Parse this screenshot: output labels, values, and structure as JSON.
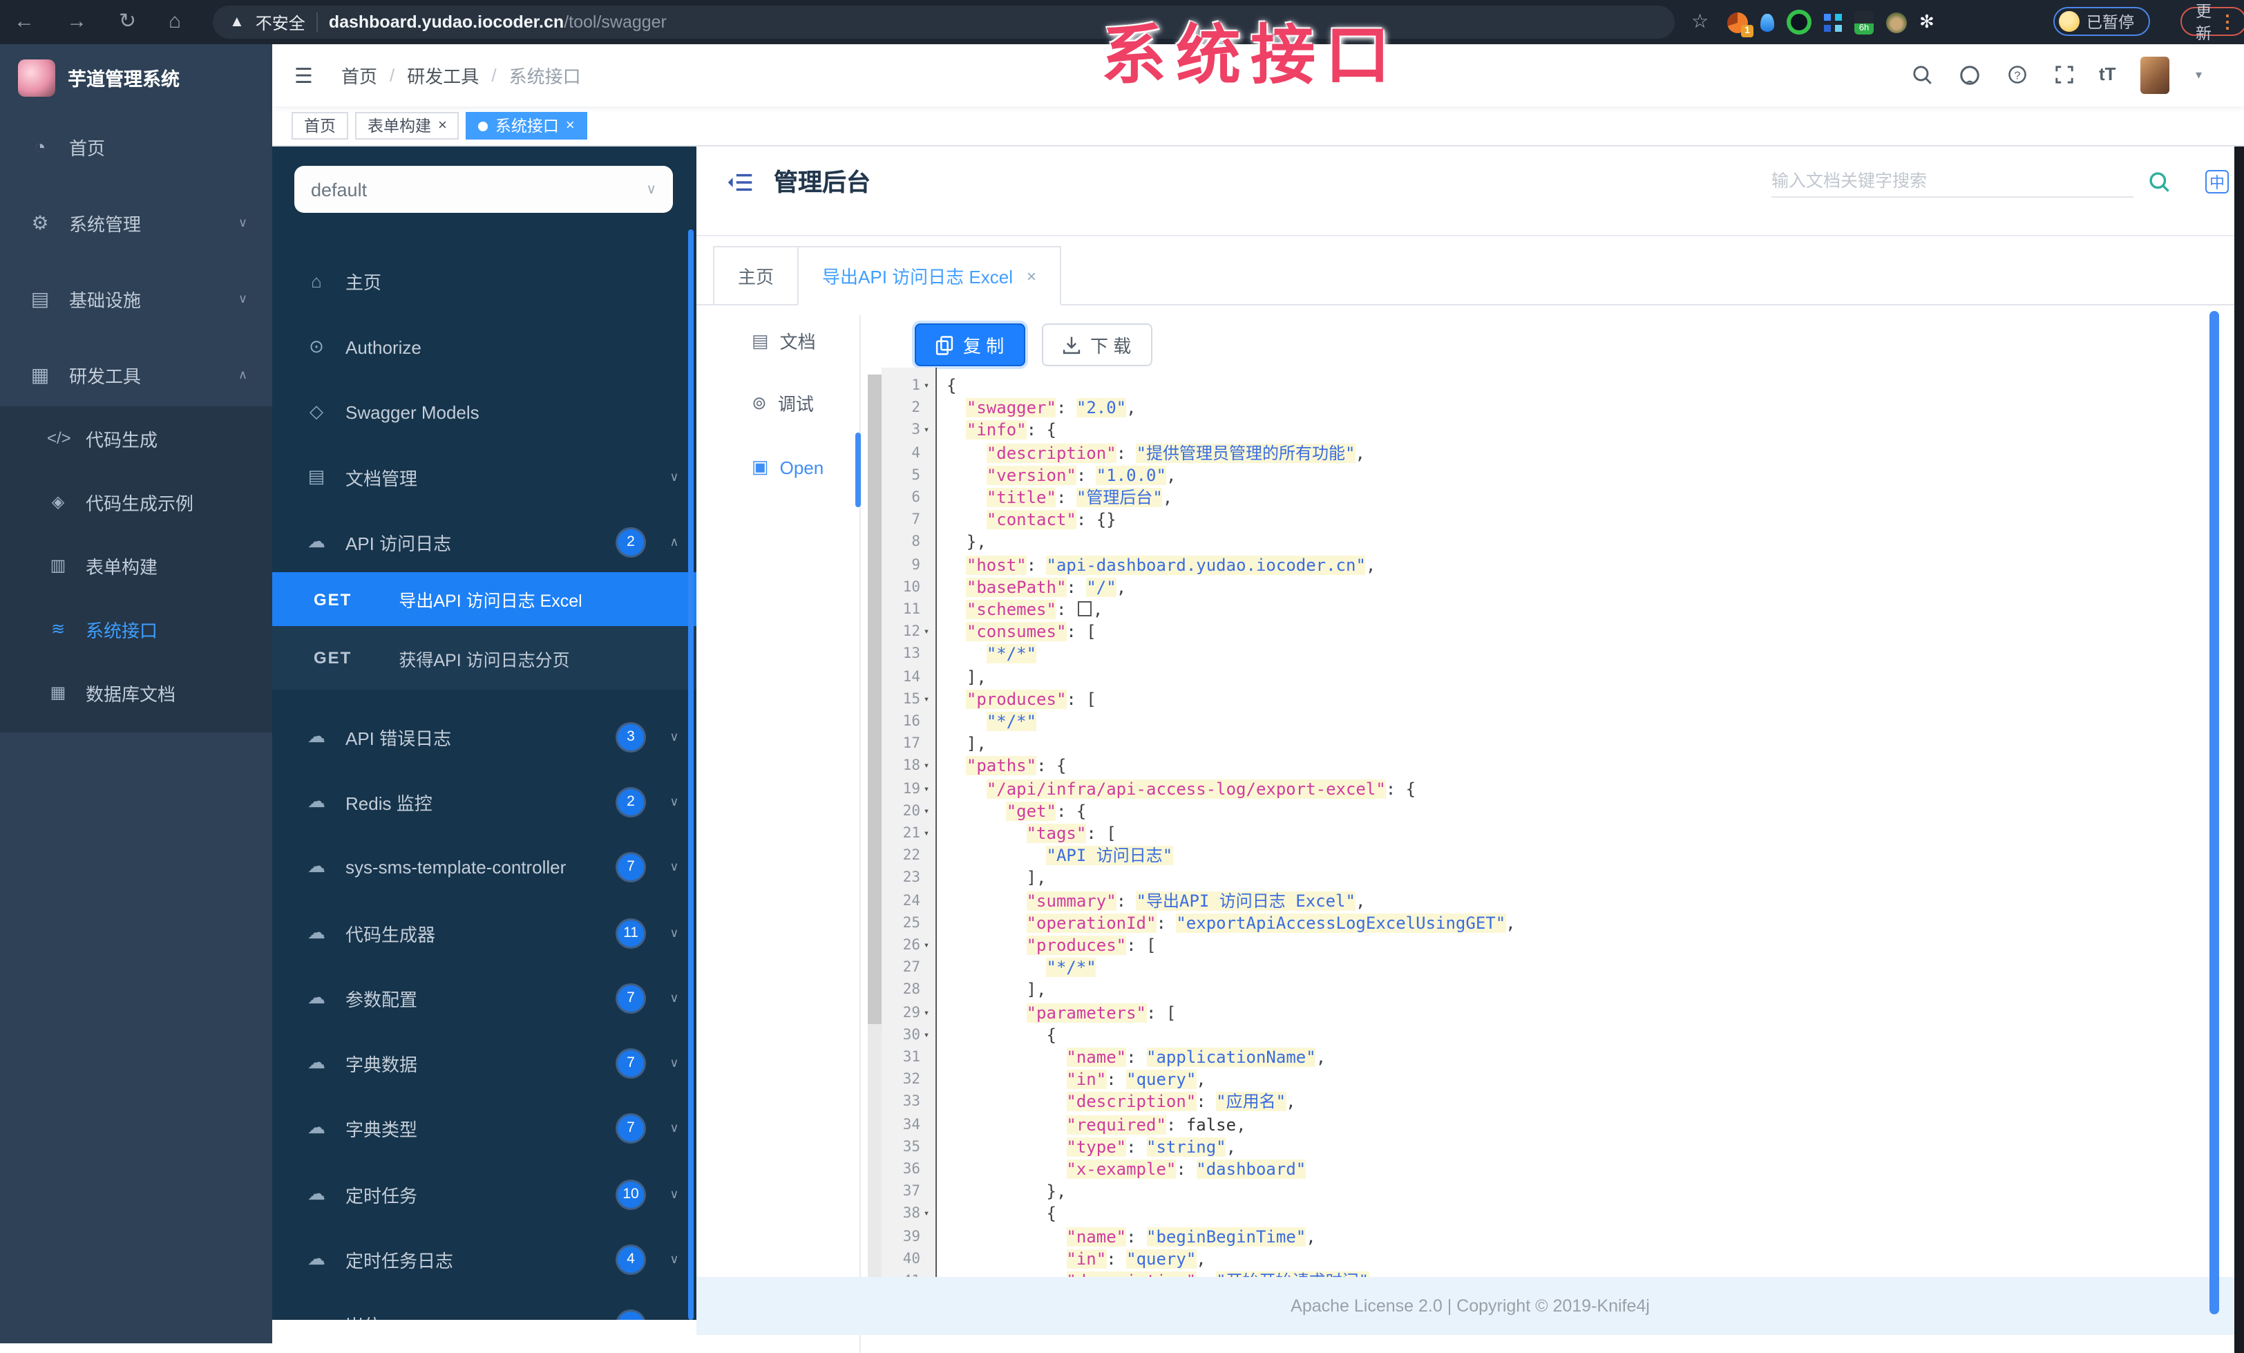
{
  "watermark": "系统接口",
  "colors": {
    "accent": "#1e80fe",
    "menu_active": "#409eff",
    "watermark": "#ee4165",
    "code_key": "#cf3c9f",
    "code_string": "#3a6ce0",
    "doc_panel": "#16344b",
    "sidebar": "#2e4156"
  },
  "browser": {
    "security_label": "不安全",
    "url_host": "dashboard.yudao.iocoder.cn",
    "url_path": "/tool/swagger",
    "ext_badge": "1",
    "ext_bottle_label": "6h",
    "paused_label": "已暂停",
    "update_label": "更新"
  },
  "app": {
    "logo_title": "芋道管理系统",
    "breadcrumb": [
      "首页",
      "研发工具",
      "系统接口"
    ],
    "tags": [
      {
        "label": "首页",
        "active": false,
        "closable": false
      },
      {
        "label": "表单构建",
        "active": false,
        "closable": true
      },
      {
        "label": "系统接口",
        "active": true,
        "closable": true
      }
    ]
  },
  "sidebar": {
    "items": [
      {
        "label": "首页",
        "icon": "dashboard-icon"
      },
      {
        "label": "系统管理",
        "icon": "gear-icon",
        "arrow": "down"
      },
      {
        "label": "基础设施",
        "icon": "monitor-icon",
        "arrow": "down"
      },
      {
        "label": "研发工具",
        "icon": "toolbox-icon",
        "arrow": "up"
      }
    ],
    "subitems": [
      {
        "label": "代码生成",
        "icon": "code-icon"
      },
      {
        "label": "代码生成示例",
        "icon": "shield-icon"
      },
      {
        "label": "表单构建",
        "icon": "form-icon"
      },
      {
        "label": "系统接口",
        "icon": "swagger-icon",
        "active": true
      },
      {
        "label": "数据库文档",
        "icon": "db-icon"
      }
    ]
  },
  "docmenu": {
    "group_select_value": "default",
    "items": [
      {
        "type": "item",
        "label": "主页",
        "icon": "home-icon"
      },
      {
        "type": "item",
        "label": "Authorize",
        "icon": "lock-icon"
      },
      {
        "type": "item",
        "label": "Swagger Models",
        "icon": "models-icon"
      },
      {
        "type": "group",
        "label": "文档管理",
        "icon": "doc-icon",
        "arrow": "down"
      },
      {
        "type": "group",
        "label": "API 访问日志",
        "icon": "api-icon",
        "badge": "2",
        "arrow": "up"
      },
      {
        "type": "api",
        "method": "GET",
        "label": "导出API 访问日志 Excel",
        "active": true
      },
      {
        "type": "api",
        "method": "GET",
        "label": "获得API 访问日志分页"
      },
      {
        "type": "group",
        "label": "API 错误日志",
        "icon": "api-icon",
        "badge": "3",
        "arrow": "down"
      },
      {
        "type": "group",
        "label": "Redis 监控",
        "icon": "api-icon",
        "badge": "2",
        "arrow": "down"
      },
      {
        "type": "group",
        "label": "sys-sms-template-controller",
        "icon": "api-icon",
        "badge": "7",
        "arrow": "down"
      },
      {
        "type": "group",
        "label": "代码生成器",
        "icon": "api-icon",
        "badge": "11",
        "arrow": "down"
      },
      {
        "type": "group",
        "label": "参数配置",
        "icon": "api-icon",
        "badge": "7",
        "arrow": "down"
      },
      {
        "type": "group",
        "label": "字典数据",
        "icon": "api-icon",
        "badge": "7",
        "arrow": "down"
      },
      {
        "type": "group",
        "label": "字典类型",
        "icon": "api-icon",
        "badge": "7",
        "arrow": "down"
      },
      {
        "type": "group",
        "label": "定时任务",
        "icon": "api-icon",
        "badge": "10",
        "arrow": "down"
      },
      {
        "type": "group",
        "label": "定时任务日志",
        "icon": "api-icon",
        "badge": "4",
        "arrow": "down"
      },
      {
        "type": "group",
        "label": "岗位",
        "icon": "api-icon",
        "badge": "",
        "arrow": "down"
      }
    ]
  },
  "main": {
    "title": "管理后台",
    "search_placeholder": "输入文档关键字搜索",
    "lang_badge": "中",
    "tabs": [
      {
        "label": "主页",
        "active": false,
        "closable": false
      },
      {
        "label": "导出API 访问日志 Excel",
        "active": true,
        "closable": true
      }
    ],
    "rail": [
      {
        "label": "文档",
        "icon": "doc-icon",
        "active": false
      },
      {
        "label": "调试",
        "icon": "bug-icon",
        "active": false
      },
      {
        "label": "Open",
        "icon": "file-icon",
        "active": true
      }
    ],
    "copy_label": "复 制",
    "download_label": "下 载",
    "footer_text": "Apache License 2.0 | Copyright © 2019-Knife4j"
  },
  "code": {
    "lines": [
      [
        1,
        0,
        [
          [
            "p",
            "{"
          ]
        ],
        1
      ],
      [
        2,
        2,
        [
          [
            "k",
            "swagger"
          ],
          [
            "p",
            ": "
          ],
          [
            "s",
            "2.0"
          ],
          [
            "p",
            ","
          ]
        ],
        0
      ],
      [
        3,
        2,
        [
          [
            "k",
            "info"
          ],
          [
            "p",
            ": {"
          ]
        ],
        1
      ],
      [
        4,
        4,
        [
          [
            "k",
            "description"
          ],
          [
            "p",
            ": "
          ],
          [
            "s",
            "提供管理员管理的所有功能"
          ],
          [
            "p",
            ","
          ]
        ],
        0
      ],
      [
        5,
        4,
        [
          [
            "k",
            "version"
          ],
          [
            "p",
            ": "
          ],
          [
            "s",
            "1.0.0"
          ],
          [
            "p",
            ","
          ]
        ],
        0
      ],
      [
        6,
        4,
        [
          [
            "k",
            "title"
          ],
          [
            "p",
            ": "
          ],
          [
            "s",
            "管理后台"
          ],
          [
            "p",
            ","
          ]
        ],
        0
      ],
      [
        7,
        4,
        [
          [
            "k",
            "contact"
          ],
          [
            "p",
            ": {}"
          ]
        ],
        0
      ],
      [
        8,
        2,
        [
          [
            "p",
            "},"
          ]
        ],
        0
      ],
      [
        9,
        2,
        [
          [
            "k",
            "host"
          ],
          [
            "p",
            ": "
          ],
          [
            "s",
            "api-dashboard.yudao.iocoder.cn"
          ],
          [
            "p",
            ","
          ]
        ],
        0
      ],
      [
        10,
        2,
        [
          [
            "k",
            "basePath"
          ],
          [
            "p",
            ": "
          ],
          [
            "s",
            "/"
          ],
          [
            "p",
            ","
          ]
        ],
        0
      ],
      [
        11,
        2,
        [
          [
            "k",
            "schemes"
          ],
          [
            "p",
            ": "
          ],
          [
            "box",
            "[]"
          ],
          [
            "p",
            ","
          ]
        ],
        0
      ],
      [
        12,
        2,
        [
          [
            "k",
            "consumes"
          ],
          [
            "p",
            ": ["
          ]
        ],
        1
      ],
      [
        13,
        4,
        [
          [
            "s",
            "*/*"
          ]
        ],
        0
      ],
      [
        14,
        2,
        [
          [
            "p",
            "],"
          ]
        ],
        0
      ],
      [
        15,
        2,
        [
          [
            "k",
            "produces"
          ],
          [
            "p",
            ": ["
          ]
        ],
        1
      ],
      [
        16,
        4,
        [
          [
            "s",
            "*/*"
          ]
        ],
        0
      ],
      [
        17,
        2,
        [
          [
            "p",
            "],"
          ]
        ],
        0
      ],
      [
        18,
        2,
        [
          [
            "k",
            "paths"
          ],
          [
            "p",
            ": {"
          ]
        ],
        1
      ],
      [
        19,
        4,
        [
          [
            "k",
            "/api/infra/api-access-log/export-excel"
          ],
          [
            "p",
            ": {"
          ]
        ],
        1
      ],
      [
        20,
        6,
        [
          [
            "k",
            "get"
          ],
          [
            "p",
            ": {"
          ]
        ],
        1
      ],
      [
        21,
        8,
        [
          [
            "k",
            "tags"
          ],
          [
            "p",
            ": ["
          ]
        ],
        1
      ],
      [
        22,
        10,
        [
          [
            "s",
            "API 访问日志"
          ]
        ],
        0
      ],
      [
        23,
        8,
        [
          [
            "p",
            "],"
          ]
        ],
        0
      ],
      [
        24,
        8,
        [
          [
            "k",
            "summary"
          ],
          [
            "p",
            ": "
          ],
          [
            "s",
            "导出API 访问日志 Excel"
          ],
          [
            "p",
            ","
          ]
        ],
        0
      ],
      [
        25,
        8,
        [
          [
            "k",
            "operationId"
          ],
          [
            "p",
            ": "
          ],
          [
            "s",
            "exportApiAccessLogExcelUsingGET"
          ],
          [
            "p",
            ","
          ]
        ],
        0
      ],
      [
        26,
        8,
        [
          [
            "k",
            "produces"
          ],
          [
            "p",
            ": ["
          ]
        ],
        1
      ],
      [
        27,
        10,
        [
          [
            "s",
            "*/*"
          ]
        ],
        0
      ],
      [
        28,
        8,
        [
          [
            "p",
            "],"
          ]
        ],
        0
      ],
      [
        29,
        8,
        [
          [
            "k",
            "parameters"
          ],
          [
            "p",
            ": ["
          ]
        ],
        1
      ],
      [
        30,
        10,
        [
          [
            "p",
            "{"
          ]
        ],
        1
      ],
      [
        31,
        12,
        [
          [
            "k",
            "name"
          ],
          [
            "p",
            ": "
          ],
          [
            "s",
            "applicationName"
          ],
          [
            "p",
            ","
          ]
        ],
        0
      ],
      [
        32,
        12,
        [
          [
            "k",
            "in"
          ],
          [
            "p",
            ": "
          ],
          [
            "s",
            "query"
          ],
          [
            "p",
            ","
          ]
        ],
        0
      ],
      [
        33,
        12,
        [
          [
            "k",
            "description"
          ],
          [
            "p",
            ": "
          ],
          [
            "s",
            "应用名"
          ],
          [
            "p",
            ","
          ]
        ],
        0
      ],
      [
        34,
        12,
        [
          [
            "k",
            "required"
          ],
          [
            "p",
            ": "
          ],
          [
            "b",
            "false"
          ],
          [
            "p",
            ","
          ]
        ],
        0
      ],
      [
        35,
        12,
        [
          [
            "k",
            "type"
          ],
          [
            "p",
            ": "
          ],
          [
            "s",
            "string"
          ],
          [
            "p",
            ","
          ]
        ],
        0
      ],
      [
        36,
        12,
        [
          [
            "k",
            "x-example"
          ],
          [
            "p",
            ": "
          ],
          [
            "s",
            "dashboard"
          ]
        ],
        0
      ],
      [
        37,
        10,
        [
          [
            "p",
            "},"
          ]
        ],
        0
      ],
      [
        38,
        10,
        [
          [
            "p",
            "{"
          ]
        ],
        1
      ],
      [
        39,
        12,
        [
          [
            "k",
            "name"
          ],
          [
            "p",
            ": "
          ],
          [
            "s",
            "beginBeginTime"
          ],
          [
            "p",
            ","
          ]
        ],
        0
      ],
      [
        40,
        12,
        [
          [
            "k",
            "in"
          ],
          [
            "p",
            ": "
          ],
          [
            "s",
            "query"
          ],
          [
            "p",
            ","
          ]
        ],
        0
      ],
      [
        41,
        12,
        [
          [
            "k",
            "description"
          ],
          [
            "p",
            ": "
          ],
          [
            "s",
            "开始开始请求时间"
          ]
        ],
        0
      ]
    ]
  }
}
